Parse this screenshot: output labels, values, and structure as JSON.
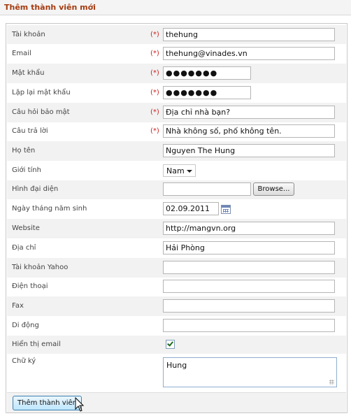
{
  "header": {
    "title": "Thêm thành viên mới"
  },
  "required_mark": "(*)",
  "fields": {
    "account": {
      "label": "Tài khoản",
      "value": "thehung"
    },
    "email": {
      "label": "Email",
      "value": "thehung@vinades.vn"
    },
    "password": {
      "label": "Mật khẩu",
      "value": "●●●●●●●"
    },
    "password_repeat": {
      "label": "Lặp lại mật khẩu",
      "value": "●●●●●●●"
    },
    "security_question": {
      "label": "Câu hỏi bảo mật",
      "value": "Địa chỉ nhà bạn?"
    },
    "security_answer": {
      "label": "Câu trả lời",
      "value": "Nhà không số, phố không tên."
    },
    "full_name": {
      "label": "Họ tên",
      "value": "Nguyen The Hung"
    },
    "gender": {
      "label": "Giới tính",
      "value": "Nam"
    },
    "avatar": {
      "label": "Hình đại diện",
      "value": "",
      "browse_label": "Browse..."
    },
    "birthday": {
      "label": "Ngày tháng năm sinh",
      "value": "02.09.2011"
    },
    "website": {
      "label": "Website",
      "value": "http://mangvn.org"
    },
    "address": {
      "label": "Địa chỉ",
      "value": "Hải Phòng"
    },
    "yahoo": {
      "label": "Tài khoản Yahoo",
      "value": ""
    },
    "phone": {
      "label": "Điện thoại",
      "value": ""
    },
    "fax": {
      "label": "Fax",
      "value": ""
    },
    "mobile": {
      "label": "Di động",
      "value": ""
    },
    "show_email": {
      "label": "Hiển thị email",
      "checked": true
    },
    "signature": {
      "label": "Chữ ký",
      "value": "Hung"
    }
  },
  "submit": {
    "label": "Thêm thành viên"
  },
  "icons": {
    "calendar": "calendar-icon",
    "dropdown": "chevron-down-icon",
    "cursor": "mouse-pointer-icon"
  },
  "colors": {
    "title": "#a43b10",
    "required": "#cc2222",
    "row_alt": "#f2f2f2"
  }
}
